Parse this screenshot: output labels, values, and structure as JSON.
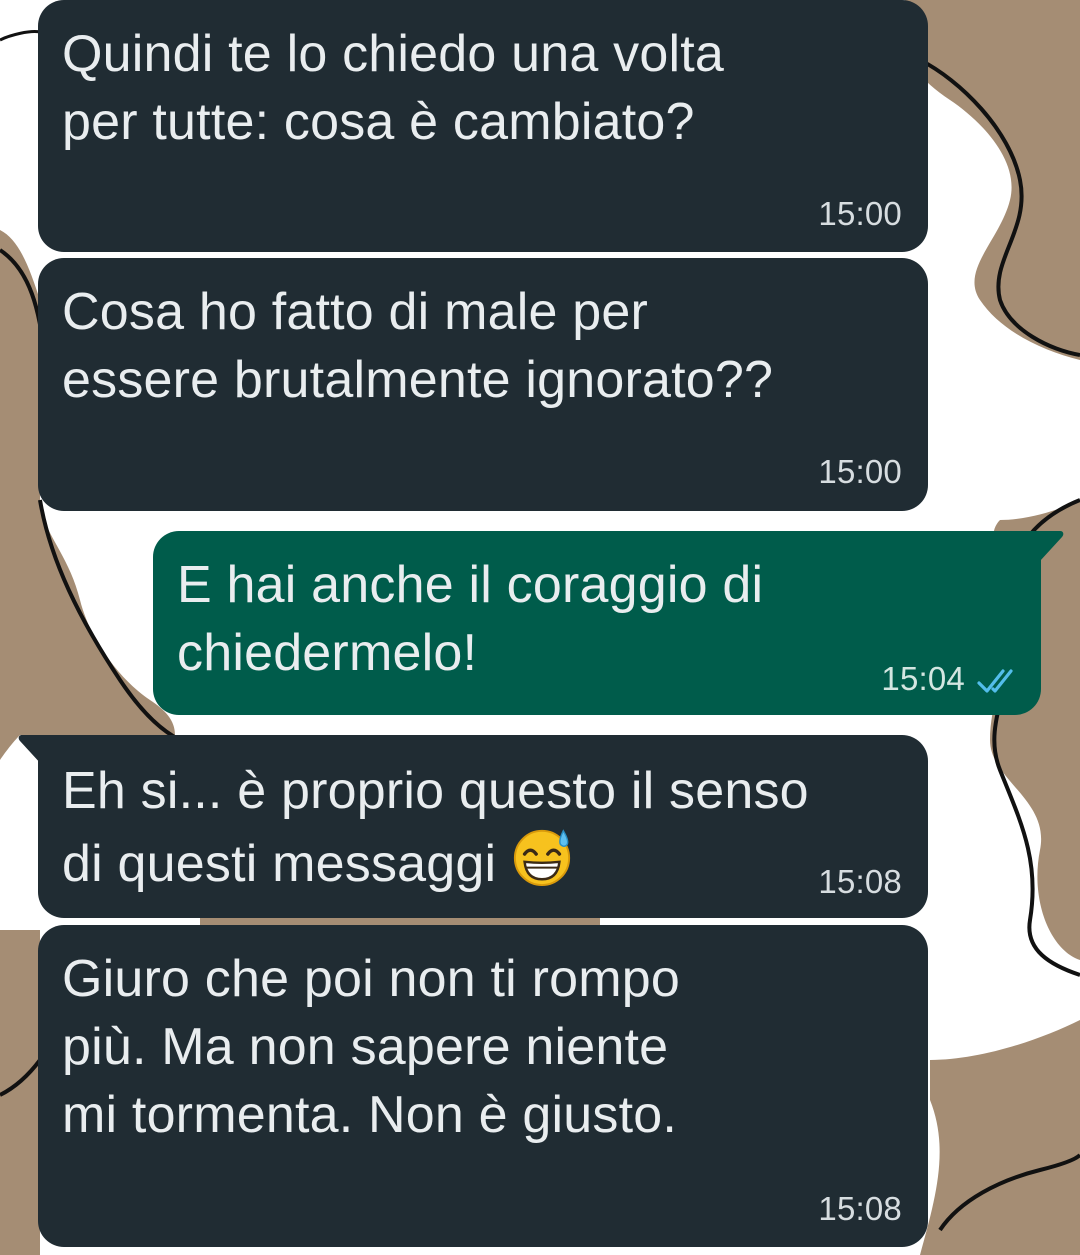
{
  "chat": {
    "messages": [
      {
        "direction": "incoming",
        "text": "Quindi te lo chiedo una volta\nper tutte: cosa è cambiato?",
        "time": "15:00"
      },
      {
        "direction": "incoming",
        "text": "Cosa ho fatto di male per\nessere brutalmente ignorato??",
        "time": "15:00"
      },
      {
        "direction": "outgoing",
        "text": "E hai anche il coraggio di\nchiedermelo!",
        "time": "15:04",
        "status_icon": "double-check-read-icon"
      },
      {
        "direction": "incoming",
        "text_line1": "Eh si... è proprio questo il senso",
        "text_line2": "di questi messaggi",
        "emoji": "grinning-face-with-sweat-emoji",
        "time": "15:08"
      },
      {
        "direction": "incoming",
        "text": "Giuro che poi non ti rompo\npiù. Ma non sapere niente\nmi tormenta. Non è giusto.",
        "time": "15:08"
      }
    ]
  },
  "colors": {
    "incoming_bubble": "#202c33",
    "outgoing_bubble": "#005c4b",
    "read_ticks": "#53bdeb",
    "wallpaper_shape": "#a58d74",
    "wallpaper_background": "#ffffff"
  }
}
